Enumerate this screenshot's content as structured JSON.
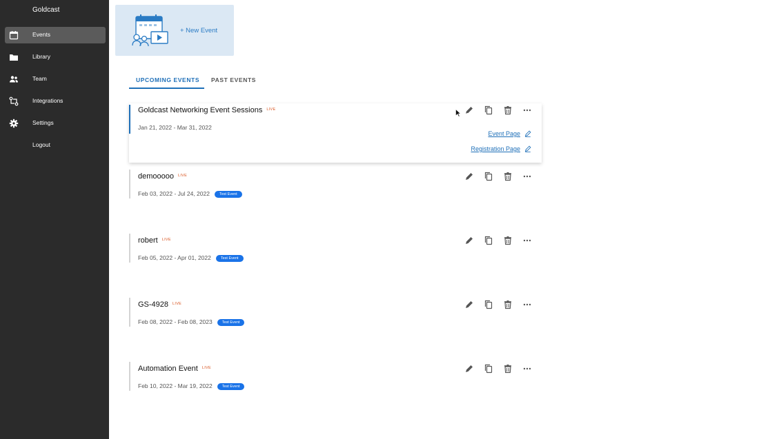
{
  "app": {
    "brand": "Goldcast"
  },
  "sidebar": {
    "items": [
      {
        "label": "Events",
        "icon": "calendar-icon",
        "active": true
      },
      {
        "label": "Library",
        "icon": "folder-icon",
        "active": false
      },
      {
        "label": "Team",
        "icon": "people-icon",
        "active": false
      },
      {
        "label": "Integrations",
        "icon": "integrations-icon",
        "active": false
      },
      {
        "label": "Settings",
        "icon": "gear-icon",
        "active": false
      },
      {
        "label": "Logout",
        "icon": "",
        "active": false
      }
    ]
  },
  "new_event": {
    "label": "+ New Event",
    "icon": "calendar-video-illustration"
  },
  "tabs": [
    {
      "label": "UPCOMING EVENTS",
      "active": true
    },
    {
      "label": "PAST EVENTS",
      "active": false
    }
  ],
  "events": [
    {
      "title": "Goldcast Networking Event Sessions",
      "live": "LIVE",
      "dates": "Jan 21, 2022 - Mar 31, 2022",
      "badge": "",
      "links": {
        "event_page": "Event Page",
        "registration_page": "Registration Page"
      }
    },
    {
      "title": "demooooo",
      "live": "LIVE",
      "dates": "Feb 03, 2022 - Jul 24, 2022",
      "badge": "Test Event"
    },
    {
      "title": "robert",
      "live": "LIVE",
      "dates": "Feb 05, 2022 - Apr 01, 2022",
      "badge": "Test Event"
    },
    {
      "title": "GS-4928",
      "live": "LIVE",
      "dates": "Feb 08, 2022 - Feb 08, 2023",
      "badge": "Test Event"
    },
    {
      "title": "Automation Event",
      "live": "LIVE",
      "dates": "Feb 10, 2022 - Mar 19, 2022",
      "badge": "Test Event"
    }
  ],
  "colors": {
    "sidebar_bg": "#2b2b2b",
    "accent": "#1e6fb8",
    "live": "#d9531e",
    "badge_bg": "#1a73e8",
    "card_bg": "#dbe8f4"
  }
}
